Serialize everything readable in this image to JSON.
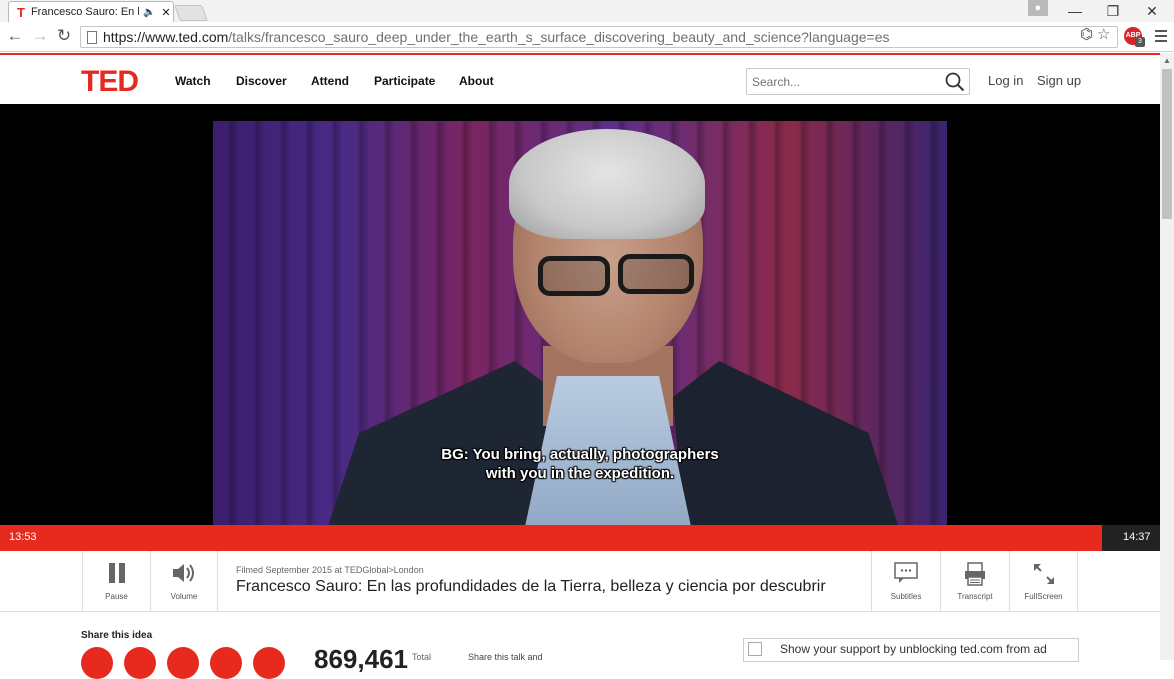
{
  "browser": {
    "tab_title": "Francesco Sauro: En las profundidades de la Tierra, belleza y ciencia por descubrir",
    "url_host": "https://www.ted.com",
    "url_path": "/talks/francesco_sauro_deep_under_the_earth_s_surface_discovering_beauty_and_science?language=es",
    "adblock_count": "3"
  },
  "header": {
    "logo": "TED",
    "nav": [
      "Watch",
      "Discover",
      "Attend",
      "Participate",
      "About"
    ],
    "search_placeholder": "Search...",
    "login": "Log in",
    "signup": "Sign up"
  },
  "video": {
    "subtitle_line1": "BG: You bring, actually, photographers",
    "subtitle_line2": "with you in the expedition.",
    "elapsed": "13:53",
    "duration": "14:37",
    "progress_fraction": 0.95
  },
  "controls": {
    "pause": "Pause",
    "volume": "Volume",
    "filmed": "Filmed September 2015 at TEDGlobal>London",
    "title": "Francesco Sauro: En las profundidades de la Tierra, belleza y ciencia por descubrir",
    "subtitles": "Subtitles",
    "transcript": "Transcript",
    "fullscreen": "FullScreen"
  },
  "below": {
    "share_label": "Share this idea",
    "count": "869,461",
    "count_label": "Total",
    "share_talk": "Share this talk and",
    "ad_text": "Show your support by unblocking ted.com from ad"
  },
  "colors": {
    "accent": "#e62b1e"
  }
}
